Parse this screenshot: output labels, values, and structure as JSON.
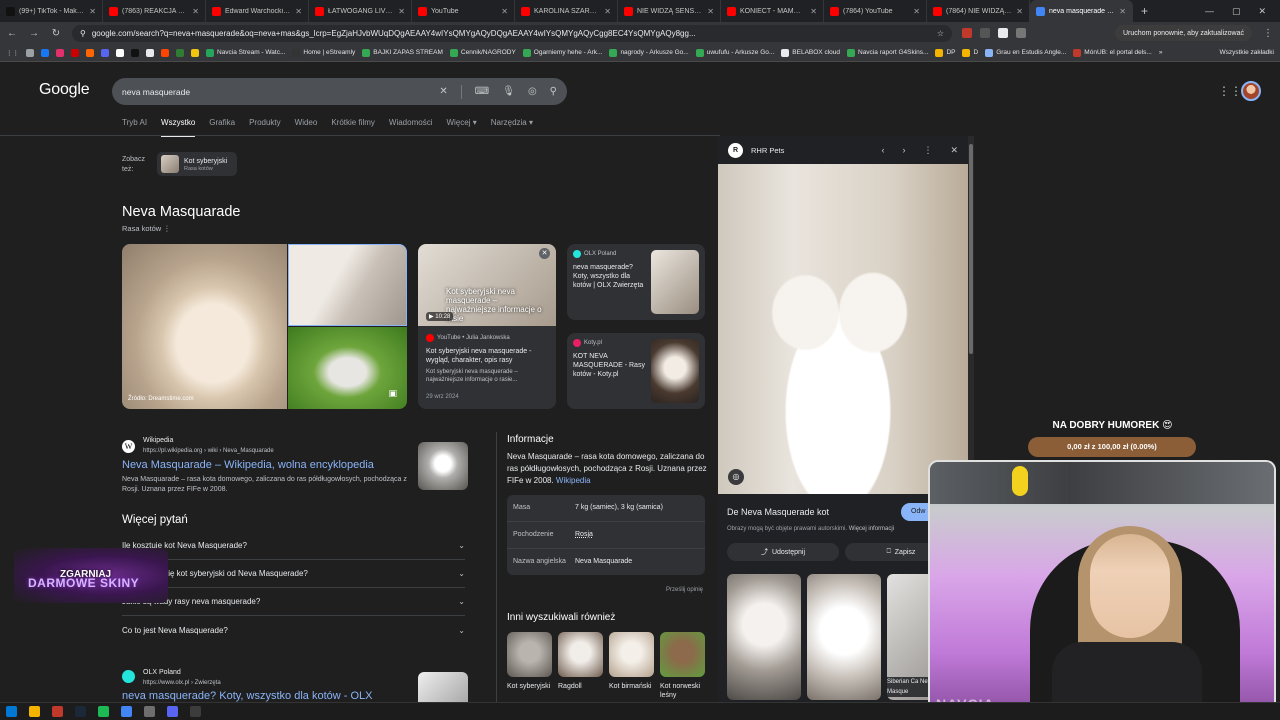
{
  "tabs": [
    {
      "label": "(99+) TikTok - Make Your",
      "color": "#111111"
    },
    {
      "label": "(7863) REAKCJA KASIX N",
      "color": "#ff0000"
    },
    {
      "label": "Edward Warchocki parodi",
      "color": "#ff0000"
    },
    {
      "label": "ŁATWOGANG LIVESTREA",
      "color": "#ff0000"
    },
    {
      "label": "YouTube",
      "color": "#ff0000"
    },
    {
      "label": "KAROLINA SZARPIE MAŁ",
      "color": "#ff0000"
    },
    {
      "label": "NIE WIDZĄ SENSU ŻYCIA",
      "color": "#ff0000"
    },
    {
      "label": "KONIECT - MAMMON OS",
      "color": "#ff0000"
    },
    {
      "label": "(7864) YouTube",
      "color": "#ff0000"
    },
    {
      "label": "(7864) NIE WIDZĄ SENSU",
      "color": "#ff0000"
    },
    {
      "label": "neva masquerade - Szuk",
      "color": "#4285f4",
      "active": true
    }
  ],
  "address": {
    "url": "google.com/search?q=neva+masquerade&oq=neva+mas&gs_lcrp=EgZjaHJvbWUqDQgAEAAY4wIYsQMYgAQyDQgAEAAY4wIYsQMYgAQyCgg8EC4YsQMYgAQy8gg..."
  },
  "restart_button": "Uruchom ponownie, aby zaktualizować",
  "bookmarks": [
    {
      "label": "",
      "color": "#9aa0a6"
    },
    {
      "label": "",
      "color": "#1877f2"
    },
    {
      "label": "",
      "color": "#e1306c"
    },
    {
      "label": "",
      "color": "#cc0000"
    },
    {
      "label": "",
      "color": "#ff6600"
    },
    {
      "label": "",
      "color": "#5865f2"
    },
    {
      "label": "",
      "color": "#ffffff"
    },
    {
      "label": "",
      "color": "#111111"
    },
    {
      "label": "",
      "color": "#e8eaed"
    },
    {
      "label": "",
      "color": "#ff4500"
    },
    {
      "label": "",
      "color": "#2f7d32"
    },
    {
      "label": "",
      "color": "#f1c40f"
    },
    {
      "label": "Navcia Stream - Watc...",
      "color": "#26a65b"
    },
    {
      "label": "Home | eStreamly",
      "color": "#333333"
    },
    {
      "label": "BAJKI ZAPAS STREAM",
      "color": "#34a853"
    },
    {
      "label": "Cennik/NAGRODY",
      "color": "#34a853"
    },
    {
      "label": "Ogarniemy hehe - Ark...",
      "color": "#34a853"
    },
    {
      "label": "nagrody - Arkusze Go...",
      "color": "#34a853"
    },
    {
      "label": "uwufufu - Arkusze Go...",
      "color": "#34a853"
    },
    {
      "label": "BELABOX cloud",
      "color": "#e8eaed"
    },
    {
      "label": "Navcia raport G4Skins...",
      "color": "#34a853"
    },
    {
      "label": "DP",
      "color": "#f4b400"
    },
    {
      "label": "D",
      "color": "#f4b400"
    },
    {
      "label": "Grau en Estudis Angle...",
      "color": "#8ab4f8"
    },
    {
      "label": "MónUB: el portal dels...",
      "color": "#c0392b"
    }
  ],
  "bookmarks_all": "Wszystkie zakładki",
  "google": {
    "logo": "Google",
    "query": "neva masquerade",
    "filters": [
      "Tryb AI",
      "Wszystko",
      "Grafika",
      "Produkty",
      "Wideo",
      "Krótkie filmy",
      "Wiadomości",
      "Więcej ▾",
      "Narzędzia ▾"
    ]
  },
  "see_also": {
    "label_1": "Zobacz",
    "label_2": "też:",
    "chip_title": "Kot syberyjski",
    "chip_sub": "Rasa kotów"
  },
  "knowledge_panel": {
    "title": "Neva Masquarade",
    "subtitle": "Rasa kotów  ⋮",
    "image_source": "Źródło: Dreamstime.com"
  },
  "video_card": {
    "overlay": "Kot syberyjski neva masquerade – najważniejsze informacje o rasie",
    "duration": "▶ 10:28",
    "source": "YouTube • Julia Jankowska",
    "title": "Kot syberyjski neva masquerade - wygląd, charakter, opis rasy",
    "desc": "Kot syberyjski neva masquerade – najważniejsze informacje o rasie...",
    "date": "29 wrz 2024"
  },
  "mini_cards": [
    {
      "source": "OLX Poland",
      "title": "neva masquerade? Koty, wszystko dla kotów | OLX Zwierzęta",
      "dot": "#23e5db"
    },
    {
      "source": "Koty.pl",
      "title": "KOT NEVA MASQUERADE - Rasy kotów - Koty.pl",
      "dot": "#e91e63"
    }
  ],
  "wiki_result": {
    "site": "Wikipedia",
    "url": "https://pl.wikipedia.org › wiki › Neva_Masquarade",
    "title": "Neva Masquarade – Wikipedia, wolna encyklopedia",
    "snippet": "Neva Masquarade – rasa kota domowego, zaliczana do ras półdługowłosych, pochodząca z Rosji. Uznana przez FIFe w 2008."
  },
  "paa": {
    "title": "Więcej pytań",
    "questions": [
      "Ile kosztuje kot Neva Masquerade?",
      "Czym różni się kot syberyjski od Neva Masquerade?",
      "Jakie są wady rasy neva masquerade?",
      "Co to jest Neva Masquerade?"
    ]
  },
  "olx_result": {
    "site": "OLX Poland",
    "url": "https://www.olx.pl › Zwierzęta",
    "title": "neva masquerade? Koty, wszystko dla kotów - OLX"
  },
  "info": {
    "title": "Informacje",
    "desc": "Neva Masquarade – rasa kota domowego, zaliczana do ras półdługowłosych, pochodząca z Rosji. Uznana przez FIFe w 2008.",
    "desc_link": "Wikipedia",
    "facts": [
      {
        "key": "Masa",
        "value": "7 kg (samiec), 3 kg (samica)"
      },
      {
        "key": "Pochodzenie",
        "value": "Rosja"
      },
      {
        "key": "Nazwa angielska",
        "value": "Neva Masquarade"
      }
    ],
    "feedback": "Prześlij opinię"
  },
  "also_searched": {
    "title": "Inni wyszukiwali również",
    "items": [
      {
        "label": "Kot syberyjski",
        "c1": "#b9b4ad",
        "c2": "#5b5650"
      },
      {
        "label": "Ragdoll",
        "c1": "#f1ede8",
        "c2": "#6d5a4c"
      },
      {
        "label": "Kot birmański",
        "c1": "#f4efe8",
        "c2": "#b3a08c"
      },
      {
        "label": "Kot norweski leśny",
        "c1": "#8c6a4b",
        "c2": "#5f9e3e"
      }
    ]
  },
  "viewer": {
    "source": "RHR Pets",
    "title": "De Neva Masquerade kot",
    "visit": "Odw",
    "note": "Obrazy mogą być objęte prawami autorskimi.",
    "note_link": "Więcej informacji",
    "share": "Udostępnij",
    "save": "Zapisz",
    "rel_caption": "Siberian Ca Neva Masque"
  },
  "stream": {
    "humor_title": "NA DOBRY HUMOREK 😍",
    "humor_progress": "0,00 zł z 100,00 zł (0.00%)",
    "skins_line1": "ZGARNIAJ",
    "skins_line2": "DARMOWE SKINY",
    "watermark": "NAVCIA"
  }
}
